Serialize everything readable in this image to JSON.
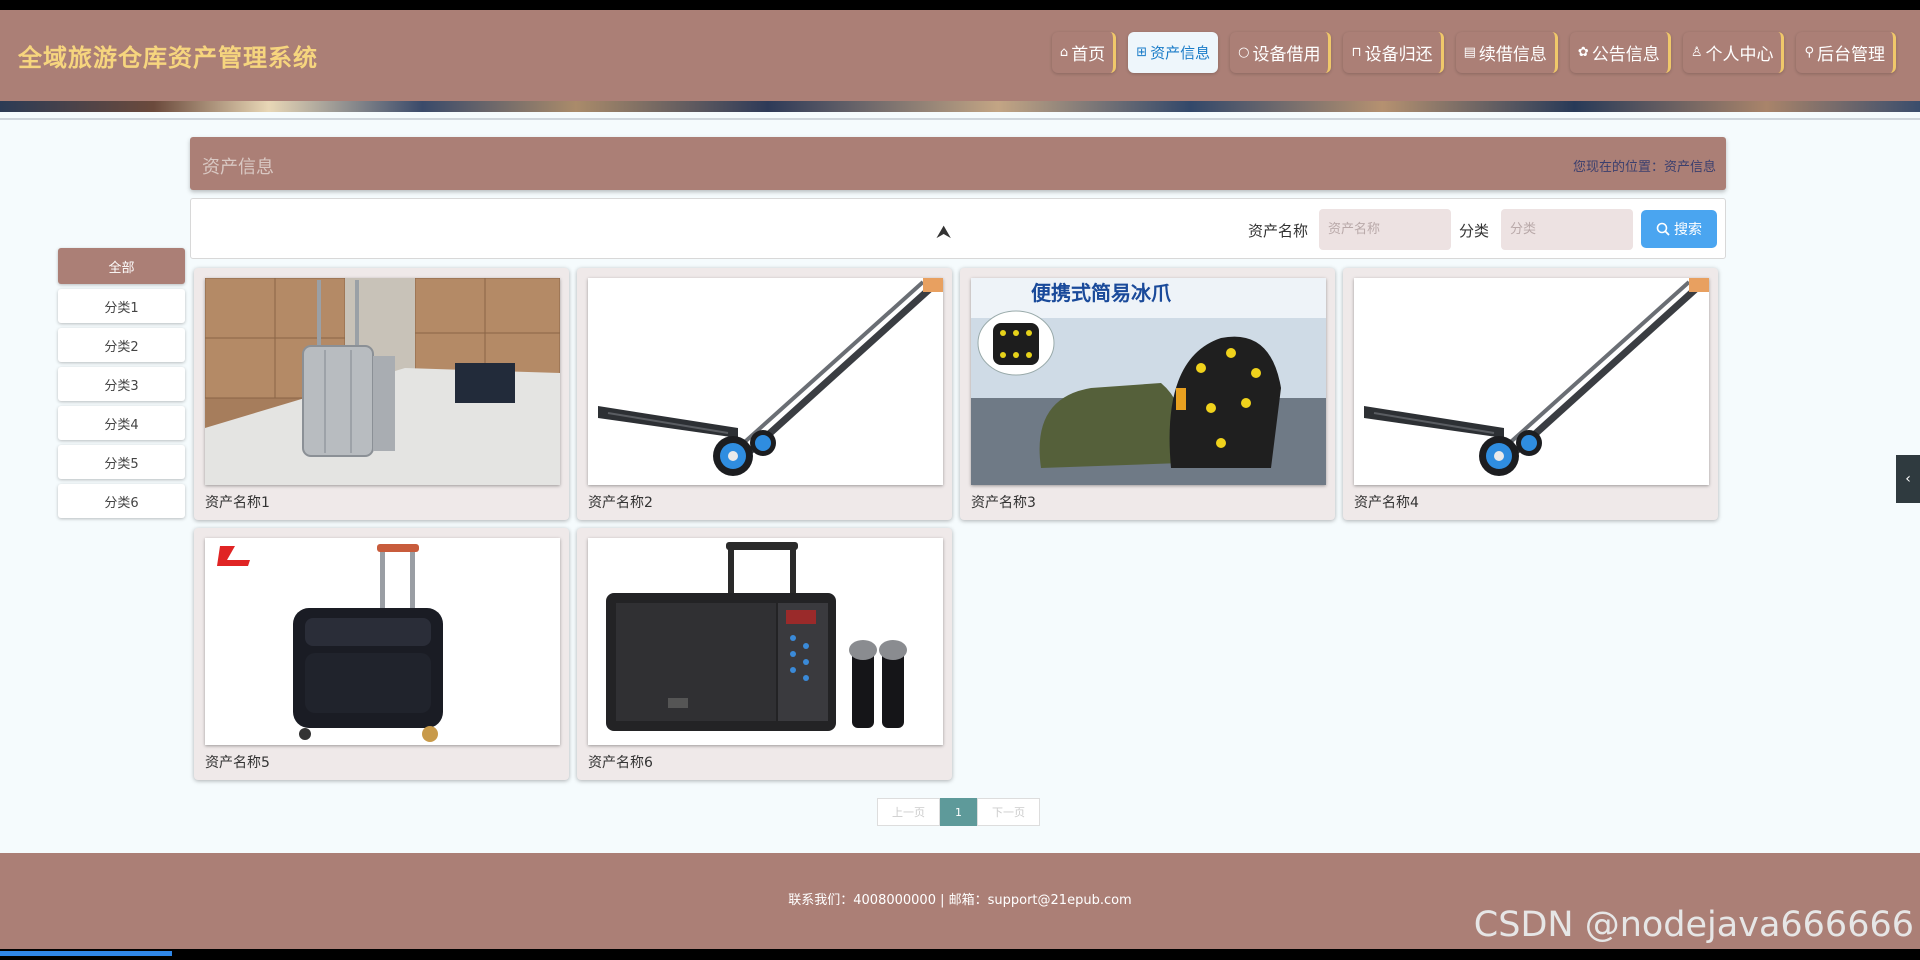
{
  "header": {
    "title": "全域旅游仓库资产管理系统",
    "nav": [
      {
        "icon": "⌂",
        "label": "首页"
      },
      {
        "icon": "⊞",
        "label": "资产信息"
      },
      {
        "icon": "○",
        "label": "设备借用"
      },
      {
        "icon": "⊓",
        "label": "设备归还"
      },
      {
        "icon": "▤",
        "label": "续借信息"
      },
      {
        "icon": "✿",
        "label": "公告信息"
      },
      {
        "icon": "♙",
        "label": "个人中心"
      },
      {
        "icon": "⚲",
        "label": "后台管理"
      }
    ],
    "active_index": 1
  },
  "crumb": {
    "title": "资产信息",
    "location": "您现在的位置：资产信息"
  },
  "search": {
    "name_label": "资产名称",
    "name_placeholder": "资产名称",
    "cat_label": "分类",
    "cat_placeholder": "分类",
    "button_label": "搜索"
  },
  "categories": [
    "全部",
    "分类1",
    "分类2",
    "分类3",
    "分类4",
    "分类5",
    "分类6"
  ],
  "items": [
    {
      "name": "资产名称1",
      "image": "silver-suitcase"
    },
    {
      "name": "资产名称2",
      "image": "hand-truck"
    },
    {
      "name": "资产名称3",
      "image": "ice-cleats",
      "image_text": "便携式简易冰爪"
    },
    {
      "name": "资产名称4",
      "image": "hand-truck"
    },
    {
      "name": "资产名称5",
      "image": "black-rolling-bag"
    },
    {
      "name": "资产名称6",
      "image": "speaker-with-microphones"
    }
  ],
  "pager": {
    "prev": "上一页",
    "current": "1",
    "next": "下一页"
  },
  "footer": {
    "text": "联系我们：4008000000 | 邮箱：support@21epub.com"
  },
  "watermark": "CSDN @nodejava666666"
}
